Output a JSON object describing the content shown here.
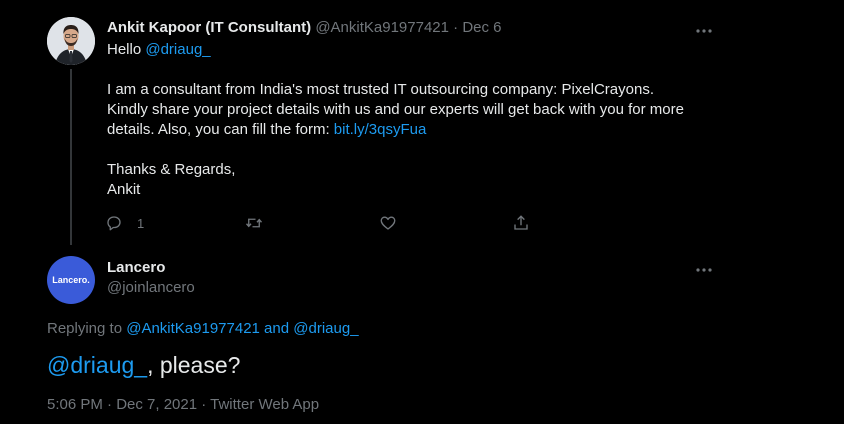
{
  "tweet1": {
    "name": "Ankit Kapoor (IT Consultant)",
    "handle": "@AnkitKa91977421",
    "separator": "·",
    "date": "Dec 6",
    "more_icon": "more-horizontal-icon",
    "greeting": "Hello ",
    "greeting_mention": "@driaug_",
    "line1": "I am a consultant from India's most trusted IT outsourcing company: PixelCrayons.",
    "line2": "Kindly share your project details with us and our experts will get back with you for more",
    "line3_prefix": "details. Also, you can fill the form: ",
    "line3_link": "bit.ly/3qsyFua",
    "sign1": "Thanks & Regards,",
    "sign2": "Ankit",
    "actions": {
      "reply_icon": "reply-icon",
      "reply_count": "1",
      "retweet_icon": "retweet-icon",
      "like_icon": "heart-icon",
      "share_icon": "share-icon"
    }
  },
  "tweet2": {
    "name": "Lancero",
    "handle": "@joinlancero",
    "avatar_text": "Lancero.",
    "more_icon": "more-horizontal-icon",
    "replying_label": "Replying to ",
    "reply_to_1": "@AnkitKa91977421",
    "reply_and": " and ",
    "reply_to_2": "@driaug_",
    "text_mention": "@driaug_",
    "text_rest": ", please?",
    "meta": "5:06 PM · Dec 7, 2021 · Twitter Web App"
  },
  "colors": {
    "background": "#000000",
    "text": "#e7e9ea",
    "muted": "#71767b",
    "link": "#1d9bf0",
    "thread_line": "#333639",
    "lancero_avatar": "#3a5bd9"
  }
}
